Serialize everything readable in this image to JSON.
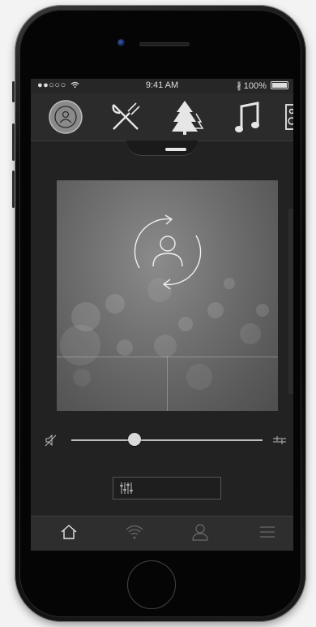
{
  "status_bar": {
    "signal": "●●○○○",
    "time": "9:41 AM",
    "battery": "100%"
  },
  "top_nav": [
    {
      "name": "profile-sync",
      "icon": "profile-sync-icon",
      "selected": true
    },
    {
      "name": "restaurant",
      "icon": "fork-knife-icon"
    },
    {
      "name": "nature",
      "icon": "trees-icon"
    },
    {
      "name": "music",
      "icon": "music-note-icon"
    },
    {
      "name": "speaker",
      "icon": "speaker-icon"
    }
  ],
  "player": {
    "volume_fraction": 0.33,
    "mute_icon": "mute-icon",
    "settings_icon": "slider-settings-icon",
    "eq_icon": "equalizer-icon"
  },
  "tab_bar": [
    {
      "name": "home",
      "icon": "home-icon",
      "active": true
    },
    {
      "name": "wifi",
      "icon": "wifi-icon"
    },
    {
      "name": "profile",
      "icon": "person-icon"
    },
    {
      "name": "menu",
      "icon": "menu-icon"
    }
  ],
  "colors": {
    "screen_bg": "#222222",
    "icon": "#e6e6e6",
    "inactive_icon": "#6a6a6a"
  }
}
